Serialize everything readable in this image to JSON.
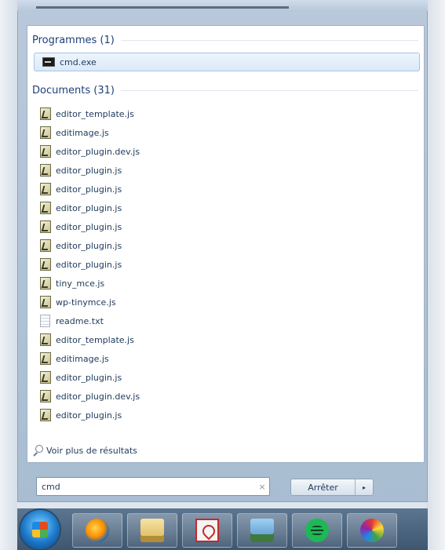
{
  "search_results": {
    "programs": {
      "header": "Programmes (1)",
      "items": [
        {
          "label": "cmd.exe",
          "icon": "console-icon"
        }
      ]
    },
    "documents": {
      "header": "Documents (31)",
      "items": [
        {
          "label": "editor_template.js",
          "icon": "js-file-icon"
        },
        {
          "label": "editimage.js",
          "icon": "js-file-icon"
        },
        {
          "label": "editor_plugin.dev.js",
          "icon": "js-file-icon"
        },
        {
          "label": "editor_plugin.js",
          "icon": "js-file-icon"
        },
        {
          "label": "editor_plugin.js",
          "icon": "js-file-icon"
        },
        {
          "label": "editor_plugin.js",
          "icon": "js-file-icon"
        },
        {
          "label": "editor_plugin.js",
          "icon": "js-file-icon"
        },
        {
          "label": "editor_plugin.js",
          "icon": "js-file-icon"
        },
        {
          "label": "editor_plugin.js",
          "icon": "js-file-icon"
        },
        {
          "label": "tiny_mce.js",
          "icon": "js-file-icon"
        },
        {
          "label": "wp-tinymce.js",
          "icon": "js-file-icon"
        },
        {
          "label": "readme.txt",
          "icon": "text-file-icon"
        },
        {
          "label": "editor_template.js",
          "icon": "js-file-icon"
        },
        {
          "label": "editimage.js",
          "icon": "js-file-icon"
        },
        {
          "label": "editor_plugin.js",
          "icon": "js-file-icon"
        },
        {
          "label": "editor_plugin.dev.js",
          "icon": "js-file-icon"
        },
        {
          "label": "editor_plugin.js",
          "icon": "js-file-icon"
        }
      ]
    },
    "see_more_label": "Voir plus de résultats"
  },
  "search": {
    "value": "cmd",
    "clear_glyph": "×"
  },
  "shutdown": {
    "label": "Arrêter",
    "arrow_glyph": "▸"
  },
  "taskbar": {
    "items": [
      {
        "icon": "windows-start-orb-icon"
      },
      {
        "icon": "firefox-icon"
      },
      {
        "icon": "file-explorer-icon"
      },
      {
        "icon": "adobe-acrobat-icon"
      },
      {
        "icon": "pictures-library-icon"
      },
      {
        "icon": "spotify-icon"
      },
      {
        "icon": "paint-icon"
      }
    ]
  },
  "colors": {
    "selection_border": "#a7c4e4",
    "link_text": "#1e395b",
    "section_header": "#1e3f7a",
    "taskbar": "#4a6481"
  }
}
